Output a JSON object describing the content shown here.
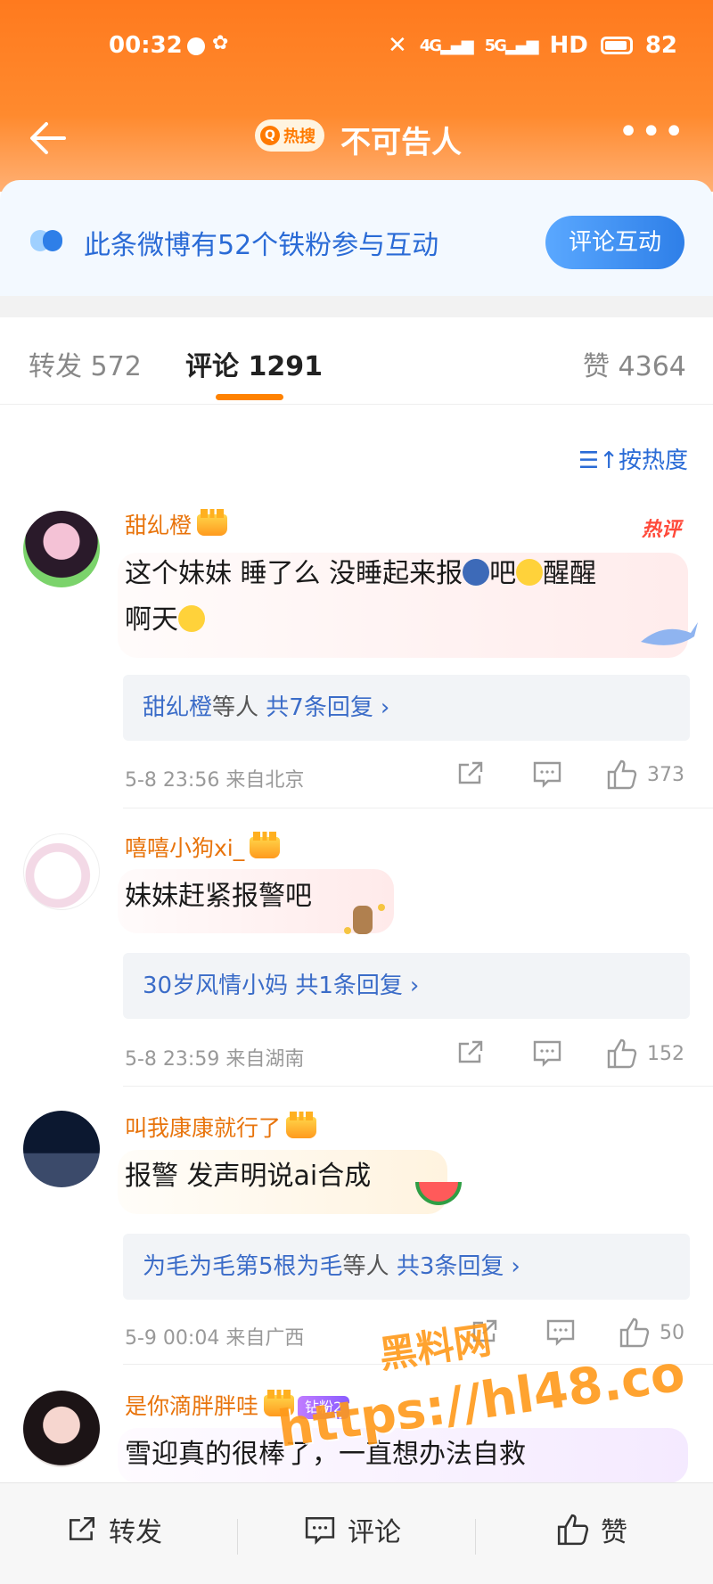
{
  "status_bar": {
    "time": "00:32",
    "network_1": "4G",
    "network_2": "5G",
    "hd": "HD",
    "battery": "82"
  },
  "nav": {
    "hot_tag": "热搜",
    "title": "不可告人"
  },
  "fans_banner": {
    "text": "此条微博有52个铁粉参与互动",
    "button": "评论互动"
  },
  "tabs": {
    "repost_label": "转发",
    "repost_count": "572",
    "comment_label": "评论",
    "comment_count": "1291",
    "like_label": "赞",
    "like_count": "4364"
  },
  "sort": {
    "label": "按热度"
  },
  "comments": [
    {
      "username": "甜乣橙",
      "hot_label": "热评",
      "text_line1": "这个妹妹 睡了么 没睡起来报",
      "text_line1b": "吧",
      "text_line1c": "醒醒",
      "text_line2": "啊天",
      "reply_user": "甜乣橙",
      "reply_suffix": "等人",
      "reply_count": "共7条回复",
      "time": "5-8 23:56",
      "location": "来自北京",
      "likes": "373"
    },
    {
      "username": "嘻嘻小狗xi_",
      "text_line1": "妹妹赶紧报警吧",
      "reply_user": "30岁风情小妈",
      "reply_suffix": "",
      "reply_count": "共1条回复",
      "time": "5-8 23:59",
      "location": "来自湖南",
      "likes": "152"
    },
    {
      "username": "叫我康康就行了",
      "text_line1": "报警 发声明说ai合成",
      "reply_user": "为毛为毛第5根为毛",
      "reply_suffix": "等人",
      "reply_count": "共3条回复",
      "time": "5-9 00:04",
      "location": "来自广西",
      "likes": "50"
    },
    {
      "username": "是你滴胖胖哇",
      "fan_tag": "钻粉2",
      "text_line1": "雪迎真的很棒了，一直想办法自救"
    }
  ],
  "watermark": {
    "line1": "黑料网",
    "line2": "https://hl48.co"
  },
  "bottom_bar": {
    "repost": "转发",
    "comment": "评论",
    "like": "赞"
  },
  "colors": {
    "header": "#ff7a1e",
    "accent": "#ff8200",
    "link": "#2a6bd6",
    "username": "#e8740c"
  }
}
